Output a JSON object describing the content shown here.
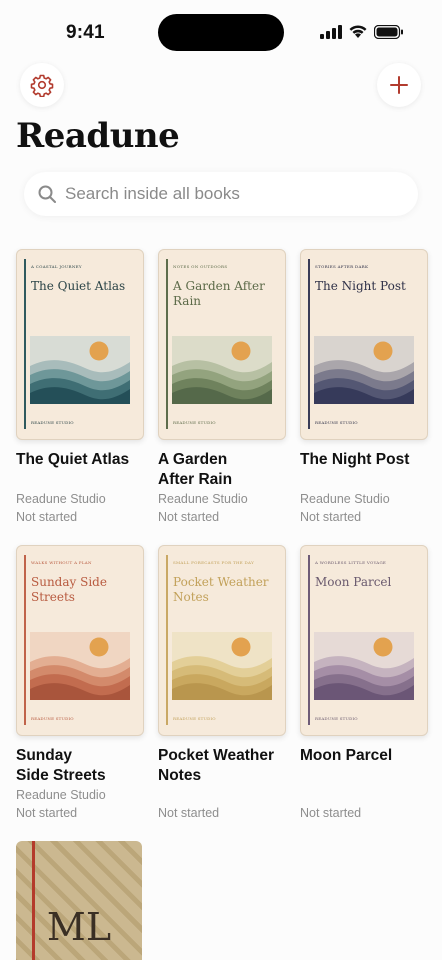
{
  "status": {
    "time": "9:41"
  },
  "header": {
    "title": "Readune",
    "settings_icon": "gear-icon",
    "add_icon": "plus-icon"
  },
  "search": {
    "placeholder": "Search inside all books",
    "value": ""
  },
  "colors": {
    "accent": "#b23b2e",
    "cover_bg": "#f6eadb",
    "sun": "#e3a24f"
  },
  "books": [
    {
      "kicker": "A coastal journey",
      "cover_title": "The Quiet Atlas",
      "imprint": "Readune Studio",
      "title_lines": [
        "The Quiet Atlas",
        ""
      ],
      "author": "Readune Studio",
      "status": "Not started",
      "palette": [
        "#d8dcd5",
        "#a8bcbb",
        "#6e9799",
        "#3f6e74",
        "#244f58"
      ],
      "title_color": "#2b4447",
      "spine_color": "#2f5a5e"
    },
    {
      "kicker": "Notes on outdoors",
      "cover_title": "A Garden After Rain",
      "imprint": "Readune Studio",
      "title_lines": [
        "A Garden",
        "After Rain"
      ],
      "author": "Readune Studio",
      "status": "Not started",
      "palette": [
        "#dcdcc9",
        "#b7c0a3",
        "#93a37e",
        "#6f825d",
        "#55694a"
      ],
      "title_color": "#5c6a48",
      "spine_color": "#5e6d4c"
    },
    {
      "kicker": "Stories after dark",
      "cover_title": "The Night Post",
      "imprint": "Readune Studio",
      "title_lines": [
        "The Night Post",
        ""
      ],
      "author": "Readune Studio",
      "status": "Not started",
      "palette": [
        "#d9d4cf",
        "#aaa6ab",
        "#7b7a8c",
        "#545773",
        "#363a5a"
      ],
      "title_color": "#2f3148",
      "spine_color": "#3a3d58"
    },
    {
      "kicker": "Walks without a plan",
      "cover_title": "Sunday Side Streets",
      "imprint": "Readune Studio",
      "title_lines": [
        "Sunday",
        "Side Streets"
      ],
      "author": "Readune Studio",
      "status": "Not started",
      "palette": [
        "#f0d6c2",
        "#e3ae92",
        "#d38a6b",
        "#c26c4f",
        "#a9553c"
      ],
      "title_color": "#b85a3f",
      "spine_color": "#c0634a"
    },
    {
      "kicker": "Small forecasts for the day",
      "cover_title": "Pocket Weather Notes",
      "imprint": "Readune Studio",
      "title_lines": [
        "Pocket Weather",
        "Notes"
      ],
      "author": "",
      "status": "Not started",
      "palette": [
        "#efe3c6",
        "#e3cf98",
        "#d6bb78",
        "#c9a85f",
        "#b9964e"
      ],
      "title_color": "#c2a15a",
      "spine_color": "#c9a865"
    },
    {
      "kicker": "A wordless little voyage",
      "cover_title": "Moon Parcel",
      "imprint": "Readune Studio",
      "title_lines": [
        "Moon Parcel",
        ""
      ],
      "author": "",
      "status": "Not started",
      "palette": [
        "#e6dad6",
        "#c5b3bf",
        "#a58ea6",
        "#86708c",
        "#6b5676"
      ],
      "title_color": "#6a5a6e",
      "spine_color": "#6e5c78"
    }
  ],
  "partial_book": {
    "cover_text": "ML"
  }
}
